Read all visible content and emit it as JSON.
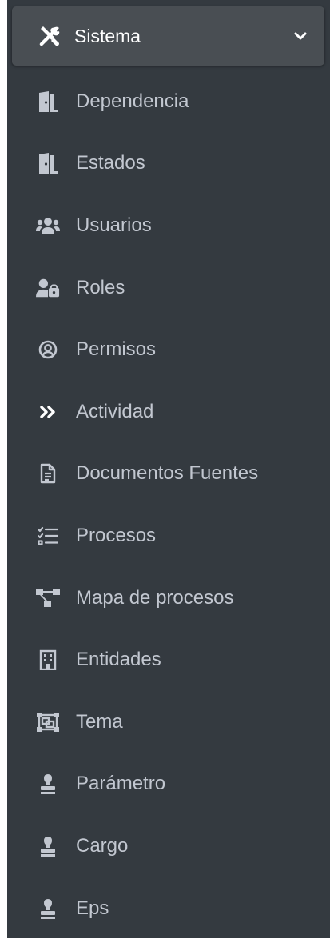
{
  "colors": {
    "sidebar_bg": "#343a40",
    "header_bg": "#494e53",
    "text": "#c2c7d0",
    "header_text": "#ffffff"
  },
  "header": {
    "label": "Sistema",
    "icon": "tools-icon",
    "toggle_icon": "chevron-down-icon"
  },
  "items": [
    {
      "label": "Dependencia",
      "icon": "door-open-icon"
    },
    {
      "label": "Estados",
      "icon": "door-open-icon"
    },
    {
      "label": "Usuarios",
      "icon": "users-icon"
    },
    {
      "label": "Roles",
      "icon": "user-lock-icon"
    },
    {
      "label": "Permisos",
      "icon": "user-circle-icon"
    },
    {
      "label": "Actividad",
      "icon": "angle-double-right-icon"
    },
    {
      "label": "Documentos Fuentes",
      "icon": "file-alt-icon"
    },
    {
      "label": "Procesos",
      "icon": "tasks-icon"
    },
    {
      "label": "Mapa de procesos",
      "icon": "project-diagram-icon"
    },
    {
      "label": "Entidades",
      "icon": "building-icon"
    },
    {
      "label": "Tema",
      "icon": "object-group-icon"
    },
    {
      "label": "Parámetro",
      "icon": "stamp-icon"
    },
    {
      "label": "Cargo",
      "icon": "stamp-icon"
    },
    {
      "label": "Eps",
      "icon": "stamp-icon"
    }
  ]
}
